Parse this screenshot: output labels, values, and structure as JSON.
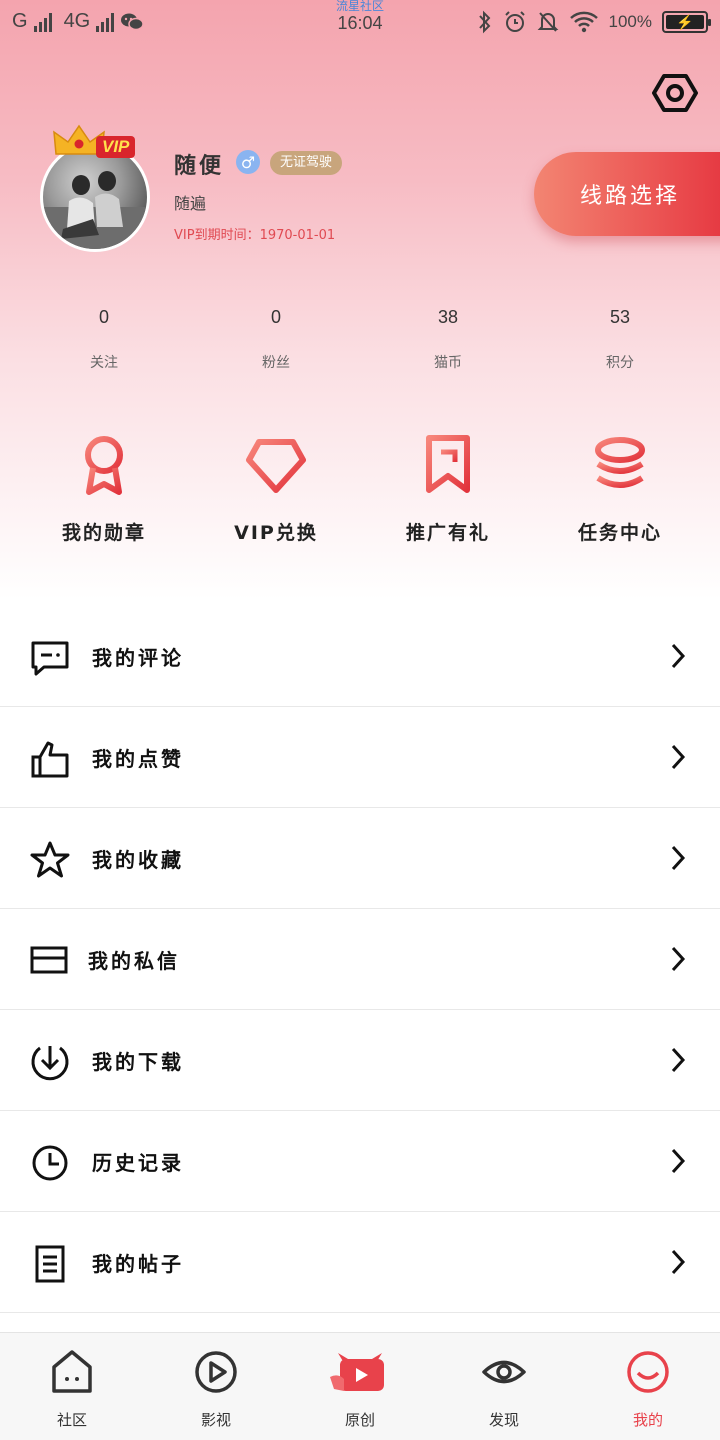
{
  "status_bar": {
    "carrier1": "G",
    "carrier2": "4G",
    "app_name": "流星社区",
    "time": "16:04",
    "battery": "100%",
    "battery_level": 1.0
  },
  "profile": {
    "vip_badge": "VIP",
    "username": "随便",
    "gender_symbol": "♂",
    "cert_badge": "无证驾驶",
    "nickname": "随遍",
    "vip_expire": "VIP到期时间：1970-01-01",
    "line_select": "线路选择"
  },
  "stats": [
    {
      "value": "0",
      "label": "关注"
    },
    {
      "value": "0",
      "label": "粉丝"
    },
    {
      "value": "38",
      "label": "猫币"
    },
    {
      "value": "53",
      "label": "积分"
    }
  ],
  "quick": [
    {
      "label": "我的勋章",
      "icon": "medal-icon"
    },
    {
      "label": "VIP兑换",
      "icon": "diamond-icon"
    },
    {
      "label": "推广有礼",
      "icon": "bookmark-icon"
    },
    {
      "label": "任务中心",
      "icon": "coins-icon"
    }
  ],
  "menu": [
    {
      "label": "我的评论",
      "icon": "comment-icon"
    },
    {
      "label": "我的点赞",
      "icon": "thumbs-up-icon"
    },
    {
      "label": "我的收藏",
      "icon": "star-icon"
    },
    {
      "label": "我的私信",
      "icon": "envelope-icon"
    },
    {
      "label": "我的下载",
      "icon": "download-icon"
    },
    {
      "label": "历史记录",
      "icon": "clock-icon"
    },
    {
      "label": "我的帖子",
      "icon": "document-icon"
    }
  ],
  "nav": [
    {
      "label": "社区",
      "icon": "home-icon"
    },
    {
      "label": "影视",
      "icon": "play-icon"
    },
    {
      "label": "原创",
      "icon": "original-icon"
    },
    {
      "label": "发现",
      "icon": "eye-icon"
    },
    {
      "label": "我的",
      "icon": "profile-smile-icon",
      "active": true
    }
  ],
  "colors": {
    "accent": "#e8424b",
    "header_gradient_top": "#f4a4ae",
    "cert_badge": "#c8a57c",
    "gender": "#8ab4f0"
  }
}
